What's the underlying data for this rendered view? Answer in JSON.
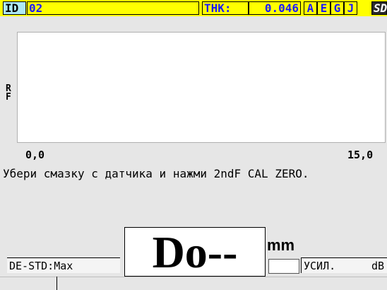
{
  "header": {
    "id_label": "ID",
    "id_value": "02",
    "thk_label": "THK:",
    "thk_value": "0.046",
    "flags": [
      "A",
      "E",
      "G",
      "J"
    ],
    "sd_label": "SD"
  },
  "waveform": {
    "axis_label": "RF",
    "x_start": "0,0",
    "x_end": "15,0"
  },
  "message": "Убери смазку с датчика и нажми 2ndF CAL ZERO.",
  "status": {
    "mode": "DE-STD:Max",
    "measurement": "Do--",
    "unit": "mm",
    "gain_label": "УСИЛ.",
    "gain_unit": "dB"
  }
}
